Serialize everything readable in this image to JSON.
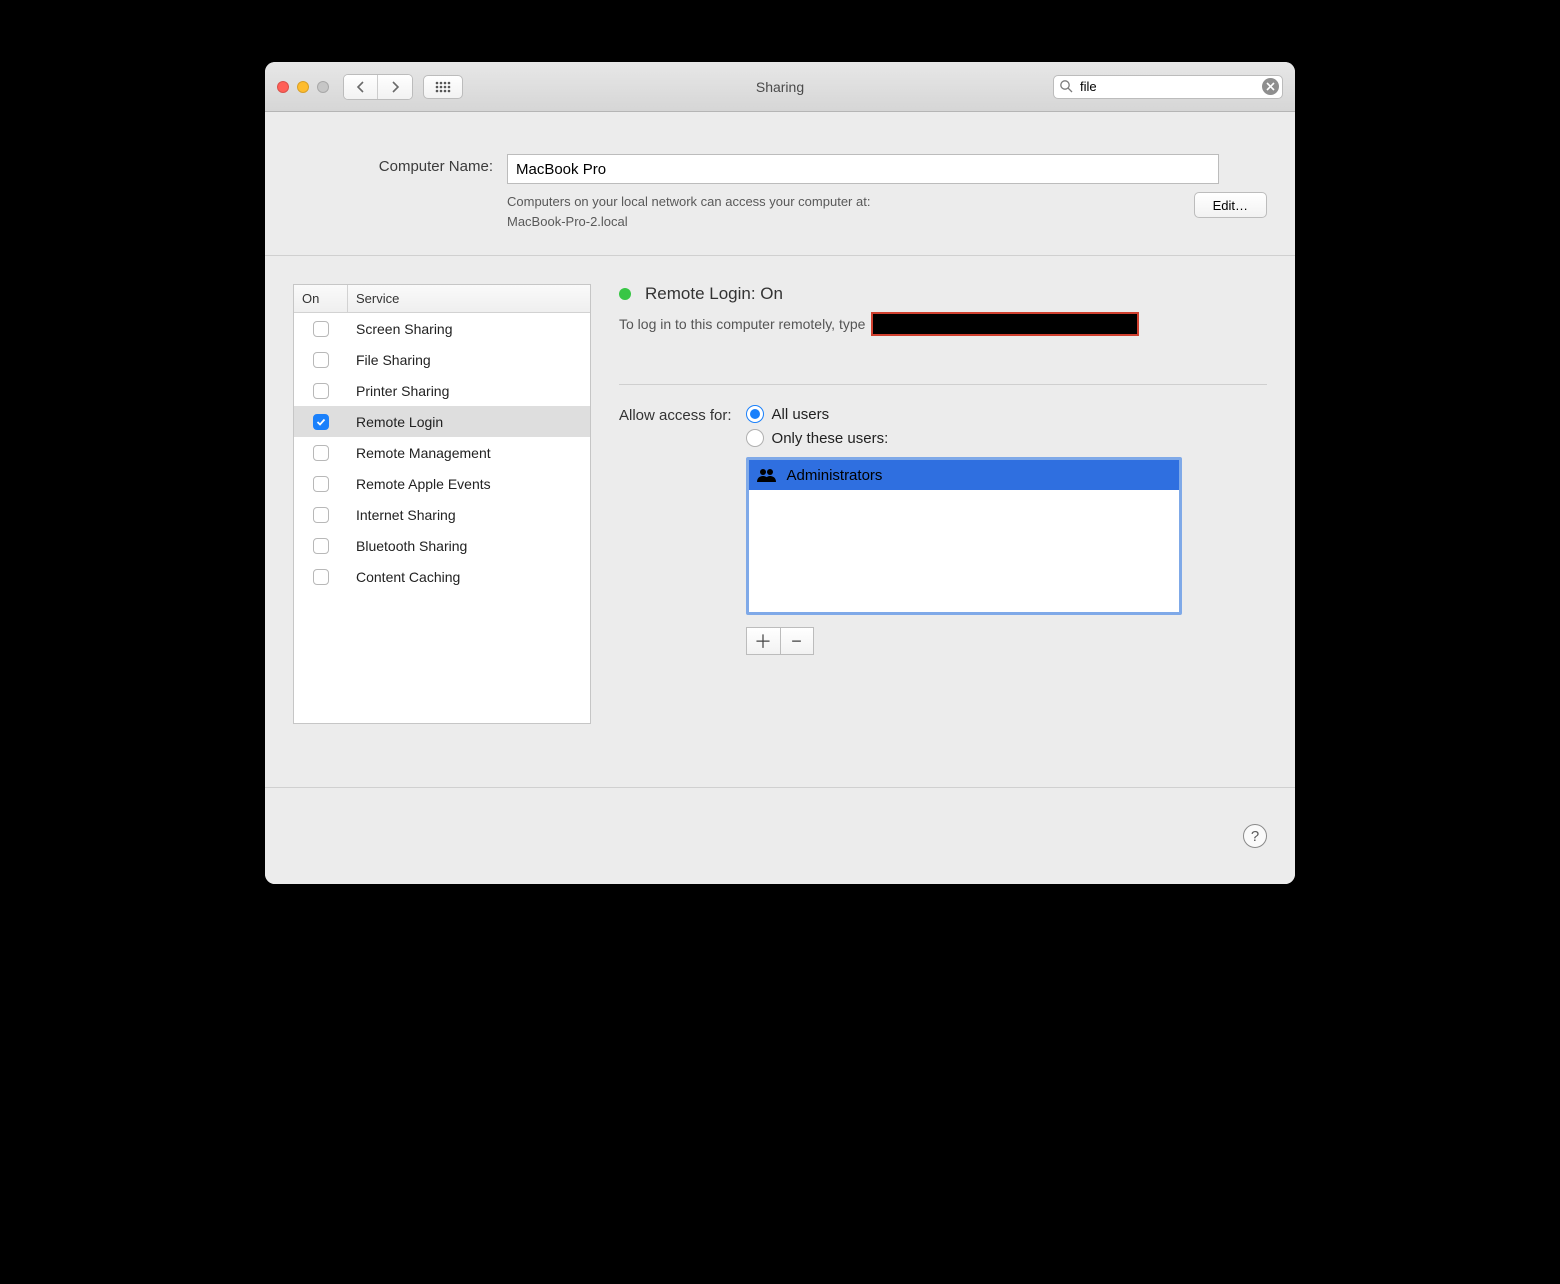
{
  "window": {
    "title": "Sharing"
  },
  "search": {
    "value": "file"
  },
  "computer_name": {
    "label": "Computer Name:",
    "value": "MacBook Pro",
    "help_line1": "Computers on your local network can access your computer at:",
    "help_line2": "MacBook-Pro-2.local",
    "edit_label": "Edit…"
  },
  "service_table": {
    "header_on": "On",
    "header_service": "Service",
    "rows": [
      {
        "on": false,
        "label": "Screen Sharing",
        "selected": false
      },
      {
        "on": false,
        "label": "File Sharing",
        "selected": false
      },
      {
        "on": false,
        "label": "Printer Sharing",
        "selected": false
      },
      {
        "on": true,
        "label": "Remote Login",
        "selected": true
      },
      {
        "on": false,
        "label": "Remote Management",
        "selected": false
      },
      {
        "on": false,
        "label": "Remote Apple Events",
        "selected": false
      },
      {
        "on": false,
        "label": "Internet Sharing",
        "selected": false
      },
      {
        "on": false,
        "label": "Bluetooth Sharing",
        "selected": false
      },
      {
        "on": false,
        "label": "Content Caching",
        "selected": false
      }
    ]
  },
  "detail": {
    "status_title": "Remote Login: On",
    "login_prefix": "To log in to this computer remotely, type",
    "access_label": "Allow access for:",
    "opt_all": "All users",
    "opt_only": "Only these users:",
    "selected_option": "all",
    "users": [
      {
        "label": "Administrators"
      }
    ]
  }
}
